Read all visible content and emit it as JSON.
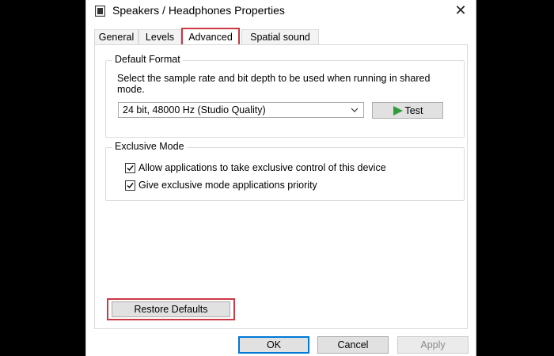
{
  "window": {
    "title": "Speakers / Headphones Properties",
    "close_label": "✕"
  },
  "tabs": [
    {
      "label": "General"
    },
    {
      "label": "Levels"
    },
    {
      "label": "Advanced",
      "selected": true
    },
    {
      "label": "Spatial sound"
    }
  ],
  "default_format": {
    "heading": "Default Format",
    "description": "Select the sample rate and bit depth to be used when running in shared mode.",
    "selected_format": "24 bit, 48000 Hz (Studio Quality)",
    "test_label": "Test"
  },
  "exclusive_mode": {
    "heading": "Exclusive Mode",
    "options": [
      {
        "label": "Allow applications to take exclusive control of this device",
        "checked": true
      },
      {
        "label": "Give exclusive mode applications priority",
        "checked": true
      }
    ]
  },
  "restore_label": "Restore Defaults",
  "buttons": {
    "ok": "OK",
    "cancel": "Cancel",
    "apply": "Apply"
  },
  "colors": {
    "highlight": "#cc3844",
    "focus": "#0078d7",
    "play": "#2e9d3a"
  }
}
